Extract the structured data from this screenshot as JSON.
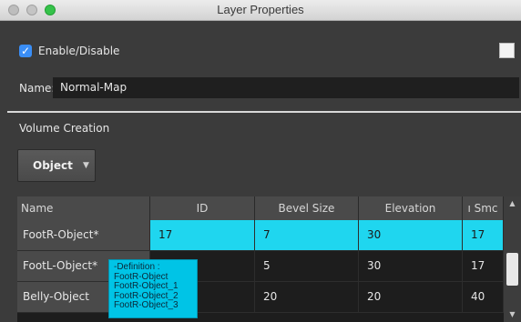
{
  "window": {
    "title": "Layer Properties"
  },
  "enable": {
    "label": "Enable/Disable",
    "checked": true
  },
  "name": {
    "label": "Name:",
    "value": "Normal-Map"
  },
  "volume": {
    "section_label": "Volume Creation",
    "mode": "Object"
  },
  "table": {
    "headers": [
      "Name",
      "ID",
      "Bevel Size",
      "Elevation",
      "ı Smc"
    ],
    "rows": [
      {
        "name": "FootR-Object*",
        "id": "17",
        "bevel": "7",
        "elevation": "30",
        "smooth": "17",
        "selected": true
      },
      {
        "name": "FootL-Object*",
        "id": "",
        "bevel": "5",
        "elevation": "30",
        "smooth": "17",
        "selected": false
      },
      {
        "name": "Belly-Object",
        "id": "",
        "bevel": "20",
        "elevation": "20",
        "smooth": "40",
        "selected": false
      }
    ]
  },
  "tooltip": {
    "lines": [
      "-Definition :",
      "FootR-Object",
      "FootR-Object_1",
      "FootR-Object_2",
      "FootR-Object_3"
    ]
  },
  "colors": {
    "selection": "#1fd6ef",
    "accent_checkbox": "#3a8ef6",
    "tooltip_bg": "#00c4e6"
  }
}
